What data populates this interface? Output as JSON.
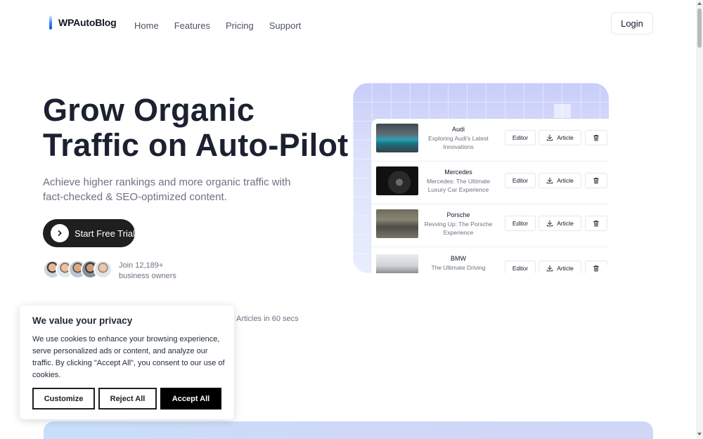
{
  "header": {
    "logo_text": "WPAutoBlog",
    "nav": [
      "Home",
      "Features",
      "Pricing",
      "Support"
    ],
    "login_label": "Login"
  },
  "hero": {
    "title_line1": "Grow Organic",
    "title_line2": "Traffic on Auto-Pilot",
    "subtitle": "Achieve higher rankings and more organic traffic with fact-checked & SEO-optimized content.",
    "cta_label": "Start Free Trial",
    "social_proof_line1": "Join 12,189+",
    "social_proof_line2": "business owners",
    "stat_text": "Articles in 60 secs"
  },
  "preview": {
    "rows": [
      {
        "brand": "Audi",
        "title": "Exploring Audi's Latest Innovations",
        "thumb_color": "#2b8a9e"
      },
      {
        "brand": "Mercedes",
        "title": "Mercedes: The Ultimate Luxury Car Experience",
        "thumb_color": "#3a3a3a"
      },
      {
        "brand": "Porsche",
        "title": "Revving Up: The Porsche Experience",
        "thumb_color": "#6b6558"
      },
      {
        "brand": "BMW",
        "title": "The Ultimate Driving Machine: BMW's Latest",
        "thumb_color": "#c9ccd2"
      }
    ],
    "editor_label": "Editor",
    "article_label": "Article"
  },
  "cookie": {
    "title": "We value your privacy",
    "text": "We use cookies to enhance your browsing experience, serve personalized ads or content, and analyze our traffic. By clicking \"Accept All\", you consent to our use of cookies.",
    "customize_label": "Customize",
    "reject_label": "Reject All",
    "accept_label": "Accept All"
  },
  "icons": {
    "cta": "chevron-right-icon",
    "article": "download-icon",
    "delete": "trash-icon"
  }
}
